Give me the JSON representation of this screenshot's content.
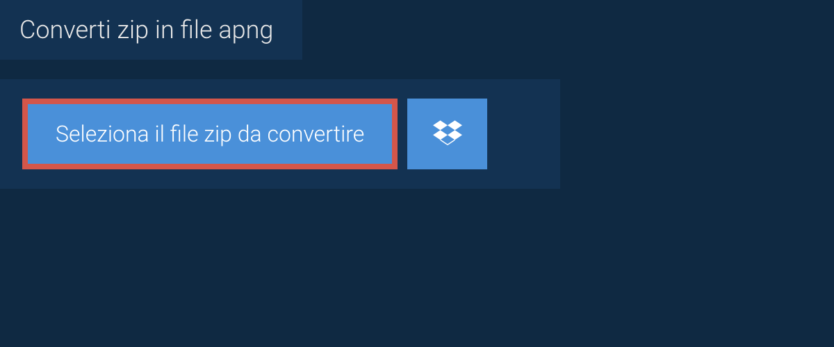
{
  "tab": {
    "title": "Converti zip in file apng"
  },
  "upload": {
    "select_file_label": "Seleziona il file zip da convertire",
    "dropbox_icon": "dropbox"
  },
  "colors": {
    "background": "#0f2942",
    "panel": "#133252",
    "button": "#4a90d9",
    "highlight_border": "#d4564a",
    "text_light": "#e8e8e8"
  }
}
